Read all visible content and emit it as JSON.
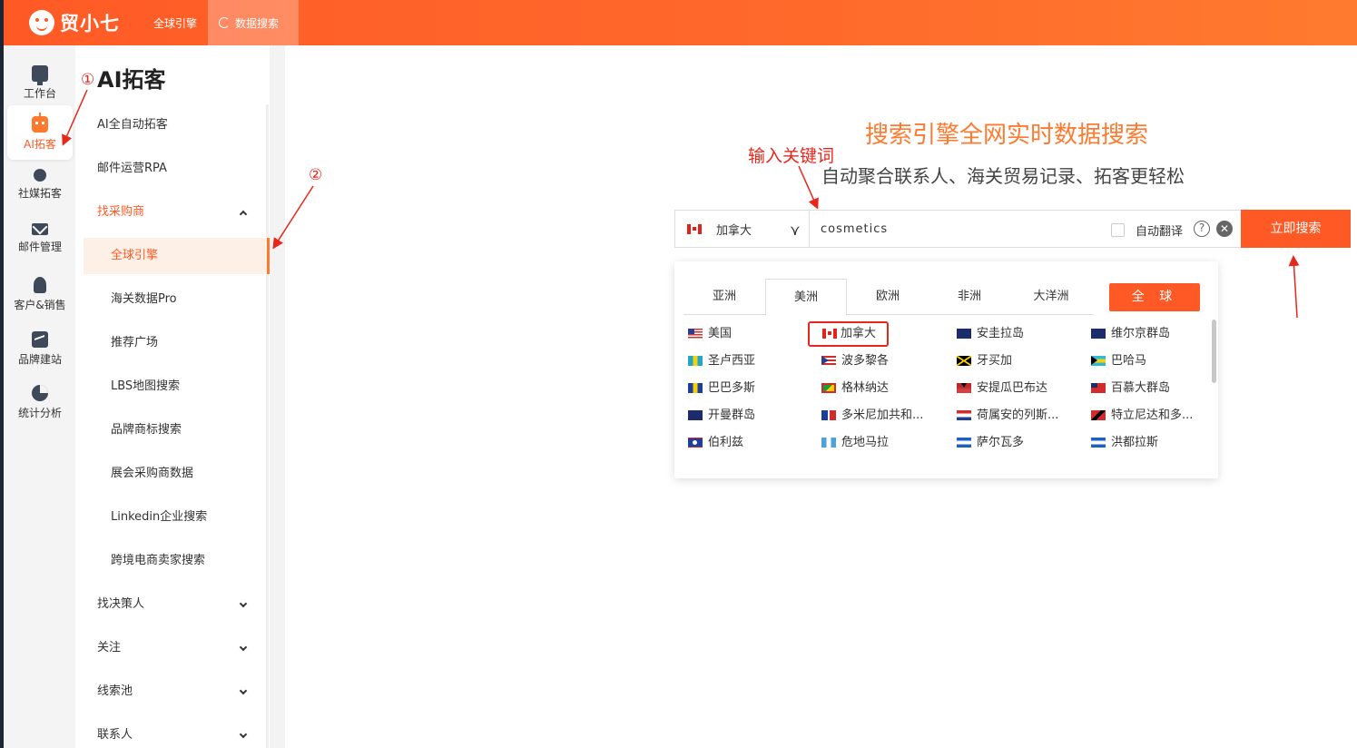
{
  "app": {
    "logo_text": "贸小七"
  },
  "topnav": [
    {
      "label": "全球引擎",
      "active": false
    },
    {
      "label": "数据搜索",
      "active": true
    }
  ],
  "rail": [
    {
      "label": "工作台",
      "icon": "desk-icon"
    },
    {
      "label": "AI拓客",
      "icon": "robot-icon",
      "active": true
    },
    {
      "label": "社媒拓客",
      "icon": "people-icon"
    },
    {
      "label": "邮件管理",
      "icon": "mail-icon"
    },
    {
      "label": "客户&销售",
      "icon": "person-icon"
    },
    {
      "label": "品牌建站",
      "icon": "chart-icon"
    },
    {
      "label": "统计分析",
      "icon": "pie-icon"
    }
  ],
  "submenu": {
    "title": "AI拓客",
    "items": [
      {
        "label": "AI全自动拓客"
      },
      {
        "label": "邮件运营RPA"
      },
      {
        "label": "找采购商",
        "expanded": true
      },
      {
        "label": "全球引擎",
        "active": true
      },
      {
        "label": "海关数据Pro"
      },
      {
        "label": "推荐广场"
      },
      {
        "label": "LBS地图搜索"
      },
      {
        "label": "品牌商标搜索"
      },
      {
        "label": "展会采购商数据"
      },
      {
        "label": "Linkedin企业搜索"
      },
      {
        "label": "跨境电商卖家搜索"
      },
      {
        "label": "找决策人"
      },
      {
        "label": "关注"
      },
      {
        "label": "线索池"
      },
      {
        "label": "联系人"
      }
    ]
  },
  "annotations": {
    "step1": "①",
    "step2": "②",
    "keyword": "输入关键词"
  },
  "hero": {
    "title": "搜索引擎全网实时数据搜索",
    "subtitle": "自动聚合联系人、海关贸易记录、拓客更轻松"
  },
  "search": {
    "country": "加拿大",
    "caret": "⋎",
    "query": "cosmetics",
    "translate_label": "自动翻译",
    "help": "?",
    "clear": "✕",
    "button": "立即搜索"
  },
  "region_panel": {
    "tabs": [
      "亚洲",
      "美洲",
      "欧洲",
      "非洲",
      "大洋洲"
    ],
    "active_tab": "美洲",
    "global_button": "全 球",
    "countries": [
      [
        "美国",
        "加拿大",
        "安圭拉岛",
        "维尔京群岛"
      ],
      [
        "圣卢西亚",
        "波多黎各",
        "牙买加",
        "巴哈马"
      ],
      [
        "巴巴多斯",
        "格林纳达",
        "安提瓜巴布达",
        "百慕大群岛"
      ],
      [
        "开曼群岛",
        "多米尼加共和...",
        "荷属安的列斯...",
        "特立尼达和多..."
      ],
      [
        "伯利兹",
        "危地马拉",
        "萨尔瓦多",
        "洪都拉斯"
      ]
    ],
    "selected": "加拿大"
  },
  "colors": {
    "brand": "#ff5a26",
    "annotation": "#e8261a",
    "hero_title": "#ff7a2f"
  }
}
